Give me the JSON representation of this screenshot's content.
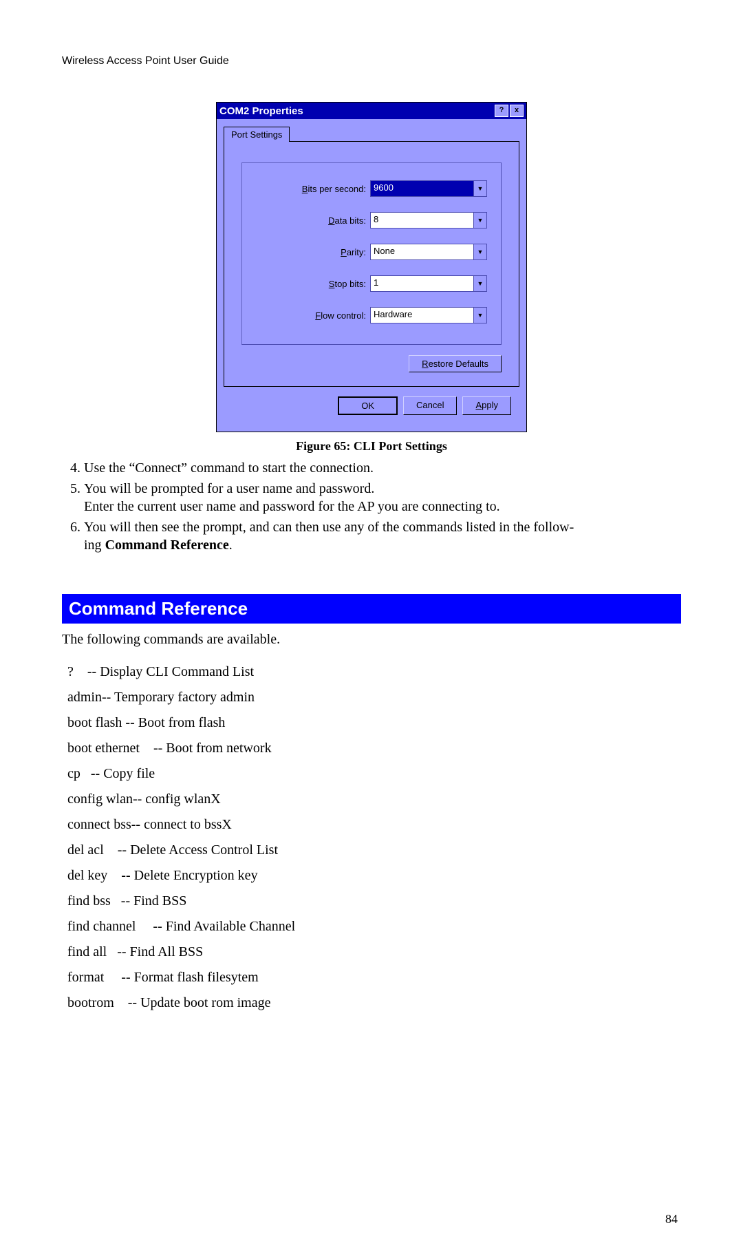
{
  "header": "Wireless Access Point User Guide",
  "dialog": {
    "title": "COM2 Properties",
    "help_btn": "?",
    "close_btn": "x",
    "tab": "Port Settings",
    "fields": {
      "bps_label_pre": "B",
      "bps_label_post": "its per second:",
      "bps_value": "9600",
      "data_label_pre": "D",
      "data_label_post": "ata bits:",
      "data_value": "8",
      "parity_label_pre": "P",
      "parity_label_post": "arity:",
      "parity_value": "None",
      "stop_label_pre": "S",
      "stop_label_post": "top bits:",
      "stop_value": "1",
      "flow_label_pre": "F",
      "flow_label_post": "low control:",
      "flow_value": "Hardware"
    },
    "restore_pre": "R",
    "restore_post": "estore Defaults",
    "ok": "OK",
    "cancel": "Cancel",
    "apply_pre": "A",
    "apply_post": "pply"
  },
  "figure_caption": "Figure 65: CLI Port Settings",
  "steps": {
    "s4": "Use the “Connect” command to start the connection.",
    "s5": "You will be prompted for a user name and password.",
    "s5b": "Enter the current user name and password for the AP you are connecting to.",
    "s6a": "You will then see the prompt, and can then use any of the commands listed in the follow-",
    "s6b": "ing ",
    "s6c": "Command Reference",
    "s6d": "."
  },
  "section_title": "Command Reference",
  "intro": "The following commands are available.",
  "commands": [
    "?    -- Display CLI Command List",
    "admin-- Temporary factory admin",
    "boot flash -- Boot from flash",
    "boot ethernet    -- Boot from network",
    "cp   -- Copy file",
    "config wlan-- config wlanX",
    "connect bss-- connect to bssX",
    "del acl    -- Delete Access Control List",
    "del key    -- Delete Encryption key",
    "find bss   -- Find BSS",
    "find channel     -- Find Available Channel",
    "find all   -- Find All BSS",
    "format     -- Format flash filesytem",
    "bootrom    -- Update boot rom image"
  ],
  "page_number": "84"
}
